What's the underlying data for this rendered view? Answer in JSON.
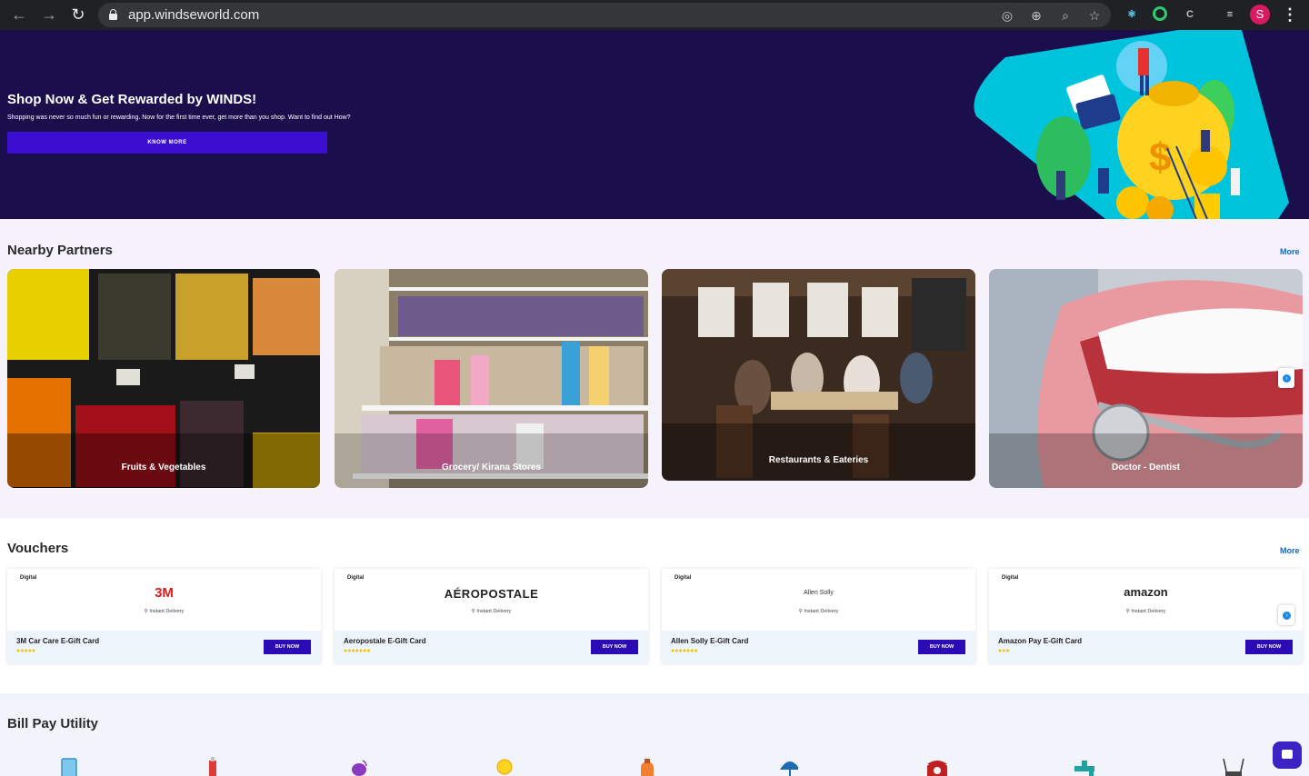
{
  "browser": {
    "url": "app.windseworld.com",
    "profile_initial": "S",
    "icons": [
      "back-arrow-icon",
      "forward-arrow-icon",
      "reload-icon",
      "lock-icon",
      "location-icon",
      "zoom-in-icon",
      "search-icon",
      "star-icon",
      "react-devtools-icon",
      "extension-icon",
      "extension-icon",
      "media-playlist-icon",
      "menu-icon"
    ]
  },
  "hero": {
    "title": "Shop Now & Get Rewarded by WINDS!",
    "subtitle": "Shopping was never so much fun or rewarding. Now for the first time ever, get more than you shop. Want to find out How?",
    "button": "KNOW MORE"
  },
  "nearby": {
    "title": "Nearby Partners",
    "more": "More",
    "cards": [
      {
        "label": "Fruits & Vegetables"
      },
      {
        "label": "Grocery/ Kirana Stores"
      },
      {
        "label": "Restaurants & Eateries"
      },
      {
        "label": "Doctor - Dentist"
      }
    ]
  },
  "vouchers": {
    "title": "Vouchers",
    "more": "More",
    "cards": [
      {
        "tag": "Digital",
        "logo": "3M",
        "delivery": "Instant Delivery",
        "name": "3M Car Care E-Gift Card",
        "stars": "●●●●●",
        "button": "BUY NOW"
      },
      {
        "tag": "Digital",
        "logo": "AÉROPOSTALE",
        "delivery": "Instant Delivery",
        "name": "Aeropostale E-Gift Card",
        "stars": "●●●●●●●",
        "button": "BUY NOW"
      },
      {
        "tag": "Digital",
        "logo": "Allen Solly",
        "delivery": "Instant Delivery",
        "name": "Allen Solly E-Gift Card",
        "stars": "●●●●●●●",
        "button": "BUY NOW"
      },
      {
        "tag": "Digital",
        "logo": "amazon",
        "delivery": "Instant Delivery",
        "name": "Amazon Pay E-Gift Card",
        "stars": "●●●",
        "button": "BUY NOW"
      }
    ]
  },
  "billpay": {
    "title": "Bill Pay Utility",
    "icons": [
      "mobile-icon",
      "datacard-icon",
      "dth-icon",
      "electricity-icon",
      "gas-cylinder-icon",
      "insurance-umbrella-icon",
      "landline-icon",
      "water-icon",
      "broadband-icon"
    ]
  },
  "colors": {
    "hero_bg": "#1a0e4d",
    "button_primary": "#3b0ed1",
    "link": "#1565c0",
    "star": "#f5c400"
  }
}
